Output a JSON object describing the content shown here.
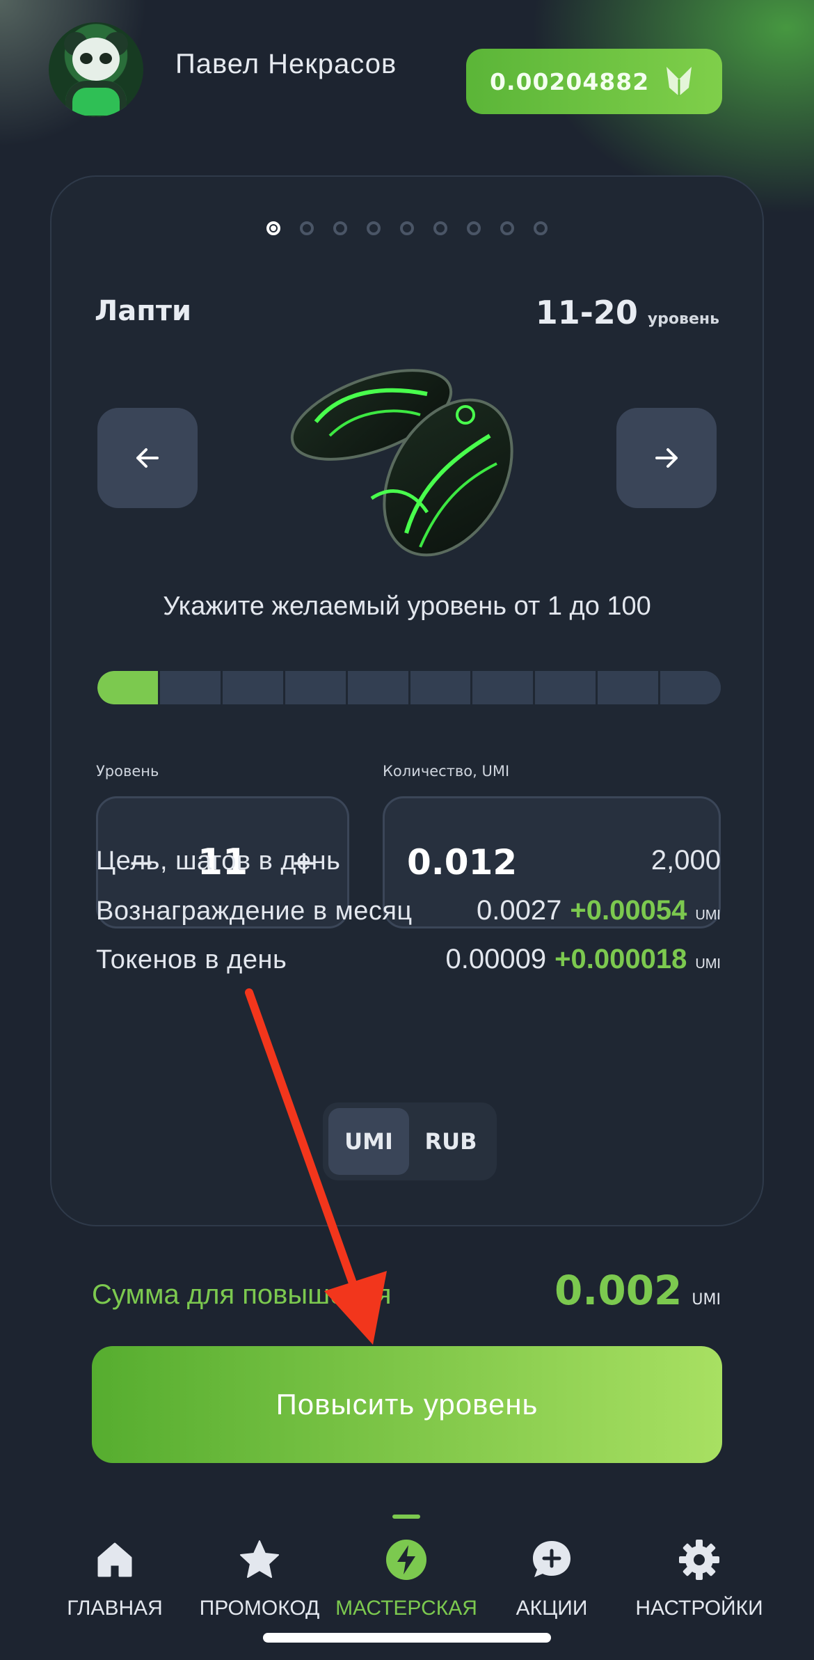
{
  "header": {
    "username": "Павел Некрасов",
    "balance": "0.00204882",
    "balance_icon": "umi-logo-icon"
  },
  "card": {
    "pagination_count": 9,
    "pagination_active": 1,
    "item_name": "Лапти",
    "level_range": "11-20",
    "level_unit": "уровень",
    "hint": "Укажите желаемый уровень от 1 до 100",
    "level_bar": {
      "segments": 10,
      "filled": 1
    },
    "level_label": "Уровень",
    "level_value": "11",
    "minus": "−",
    "plus": "+",
    "quantity_label": "Количество, UMI",
    "quantity_value": "0.012",
    "stats": {
      "steps_label": "Цель, шагов в день",
      "steps_value": "2,000",
      "monthly_label": "Вознаграждение в месяц",
      "monthly_value": "0.0027",
      "monthly_bonus": "+0.00054",
      "monthly_unit": "UMI",
      "tokens_label": "Токенов в день",
      "tokens_value": "0.00009",
      "tokens_bonus": "+0.000018",
      "tokens_unit": "UMI"
    },
    "currency": {
      "umi": "UMI",
      "rub": "RUB",
      "selected": "UMI"
    }
  },
  "summary": {
    "label": "Сумма для повышения",
    "value": "0.002",
    "unit": "UMI"
  },
  "upgrade_button": "Повысить уровень",
  "nav": {
    "items": [
      {
        "label": "ГЛАВНАЯ",
        "icon": "home-icon"
      },
      {
        "label": "ПРОМОКОД",
        "icon": "star-icon"
      },
      {
        "label": "МАСТЕРСКАЯ",
        "icon": "lightning-icon"
      },
      {
        "label": "АКЦИИ",
        "icon": "chat-plus-icon"
      },
      {
        "label": "НАСТРОЙКИ",
        "icon": "gear-icon"
      }
    ],
    "active": "МАСТЕРСКАЯ"
  },
  "colors": {
    "accent": "#7cc94f",
    "background": "#1d2430",
    "annotation_arrow": "#f2361c"
  }
}
